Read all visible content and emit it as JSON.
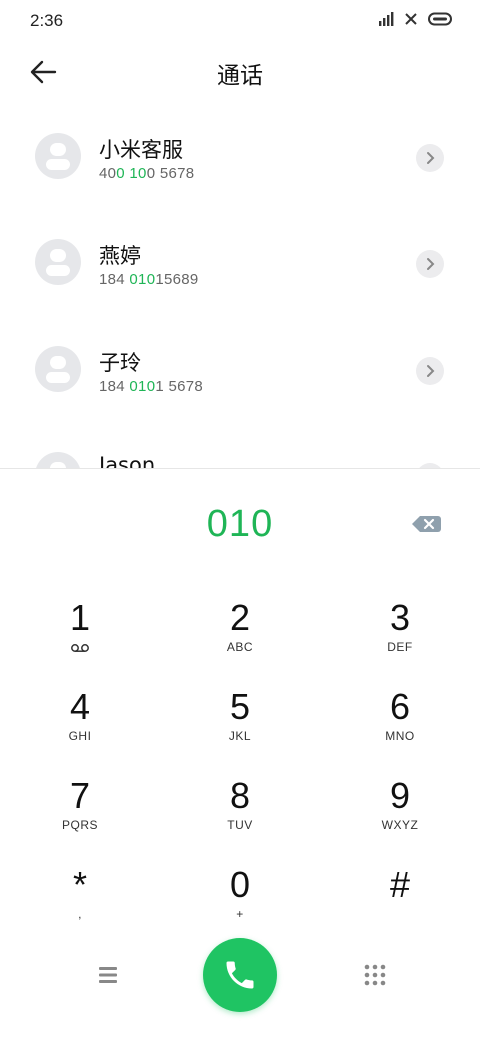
{
  "status_bar": {
    "time": "2:36",
    "icons": [
      "signal-icon",
      "no-sim-icon",
      "battery-icon"
    ]
  },
  "header": {
    "title": "通话",
    "back_icon": "arrow-left-icon"
  },
  "contacts": [
    {
      "name": "小米客服",
      "number_parts": [
        "40",
        "0 10",
        "0 5678"
      ]
    },
    {
      "name": "燕婷",
      "number_parts": [
        "184 ",
        "010",
        "15689"
      ]
    },
    {
      "name": "子玲",
      "number_parts": [
        "184 ",
        "010",
        "1 5678"
      ]
    },
    {
      "name": "Jason",
      "number_parts": [
        "",
        "",
        ""
      ]
    }
  ],
  "dialer": {
    "input": "010",
    "backspace_icon": "backspace-icon"
  },
  "keypad": [
    {
      "digit": "1",
      "letters": "",
      "icon": "voicemail-icon"
    },
    {
      "digit": "2",
      "letters": "ABC"
    },
    {
      "digit": "3",
      "letters": "DEF"
    },
    {
      "digit": "4",
      "letters": "GHI"
    },
    {
      "digit": "5",
      "letters": "JKL"
    },
    {
      "digit": "6",
      "letters": "MNO"
    },
    {
      "digit": "7",
      "letters": "PQRS"
    },
    {
      "digit": "8",
      "letters": "TUV"
    },
    {
      "digit": "9",
      "letters": "WXYZ"
    },
    {
      "digit": "*",
      "letters": ","
    },
    {
      "digit": "0",
      "letters": "+"
    },
    {
      "digit": "#",
      "letters": ""
    }
  ],
  "bottom_bar": {
    "menu_icon": "menu-icon",
    "call_icon": "phone-icon",
    "dialpad_icon": "dialpad-icon"
  },
  "colors": {
    "accent": "#1fb556",
    "call_button": "#1fc463",
    "avatar_bg": "#e6e7ea"
  }
}
